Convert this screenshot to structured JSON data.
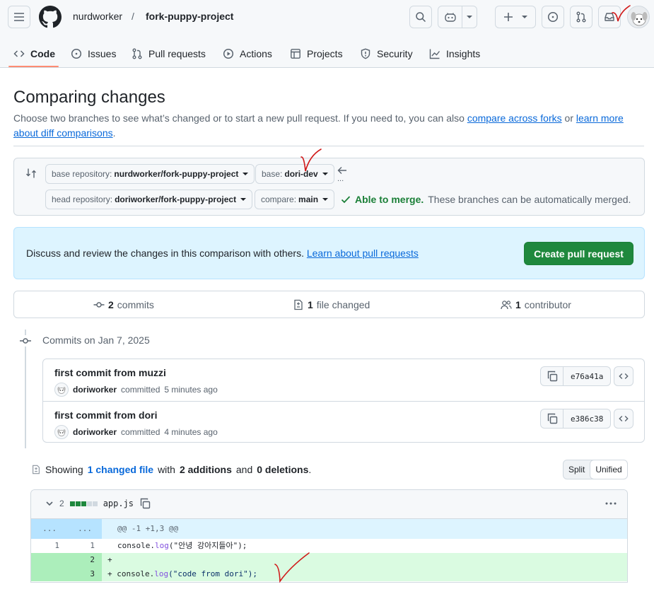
{
  "header": {
    "owner": "nurdworker",
    "separator": "/",
    "repo": "fork-puppy-project"
  },
  "tabs": [
    {
      "id": "code",
      "label": "Code",
      "icon": "code-icon",
      "active": true
    },
    {
      "id": "issues",
      "label": "Issues",
      "icon": "issue-icon"
    },
    {
      "id": "pulls",
      "label": "Pull requests",
      "icon": "pull-request-icon"
    },
    {
      "id": "actions",
      "label": "Actions",
      "icon": "play-icon"
    },
    {
      "id": "projects",
      "label": "Projects",
      "icon": "table-icon"
    },
    {
      "id": "security",
      "label": "Security",
      "icon": "shield-icon"
    },
    {
      "id": "insights",
      "label": "Insights",
      "icon": "graph-icon"
    }
  ],
  "page": {
    "title": "Comparing changes",
    "subtitle_text": "Choose two branches to see what’s changed or to start a new pull request. If you need to, you can also ",
    "compare_forks_link": "compare across forks",
    "subtitle_or": " or ",
    "learn_more_link": "learn more about diff comparisons",
    "subtitle_end": "."
  },
  "range": {
    "base_repo_label": "base repository:",
    "base_repo_value": "nurdworker/fork-puppy-project",
    "base_label": "base:",
    "base_value": "dori-dev",
    "head_repo_label": "head repository:",
    "head_repo_value": "doriworker/fork-puppy-project",
    "compare_label": "compare:",
    "compare_value": "main",
    "ellipsis": "...",
    "merge_status": "Able to merge.",
    "merge_detail": "These branches can be automatically merged."
  },
  "banner": {
    "text": "Discuss and review the changes in this comparison with others. ",
    "link": "Learn about pull requests",
    "button": "Create pull request"
  },
  "stats": {
    "commits_count": "2",
    "commits_label": "commits",
    "files_count": "1",
    "files_label": "file changed",
    "contributors_count": "1",
    "contributors_label": "contributor"
  },
  "commits": {
    "date_label": "Commits on Jan 7, 2025",
    "items": [
      {
        "title": "first commit from muzzi",
        "author": "doriworker",
        "action": "committed",
        "time": "5 minutes ago",
        "sha": "e76a41a"
      },
      {
        "title": "first commit from dori",
        "author": "doriworker",
        "action": "committed",
        "time": "4 minutes ago",
        "sha": "e386c38"
      }
    ]
  },
  "diff_summary": {
    "prefix": "Showing",
    "files_link": "1 changed file",
    "with": "with",
    "additions": "2 additions",
    "and": "and",
    "deletions": "0 deletions",
    "suffix": ".",
    "split": "Split",
    "unified": "Unified"
  },
  "file": {
    "changes": "2",
    "name": "app.js",
    "diffstat": [
      "added",
      "added",
      "added",
      "neutral",
      "neutral"
    ],
    "hunk_left": "...",
    "hunk_right": "...",
    "hunk": "@@ -1 +1,3 @@",
    "lines": [
      {
        "old": "1",
        "new": "1",
        "type": "context",
        "obj": "console.",
        "fn": "log",
        "arg": "(\"안녕 강아지들아\");"
      },
      {
        "old": "",
        "new": "2",
        "type": "add",
        "marker": "+"
      },
      {
        "old": "",
        "new": "3",
        "type": "add",
        "marker": "+ ",
        "obj": "console.",
        "fn": "log",
        "arg": "(\"code from dori\");"
      }
    ]
  },
  "colors": {
    "accent": "#0969da",
    "primary_button": "#1f883d",
    "success": "#1a7f37",
    "tab_underline": "#fd8c73",
    "annotation": "#d11a1a"
  }
}
